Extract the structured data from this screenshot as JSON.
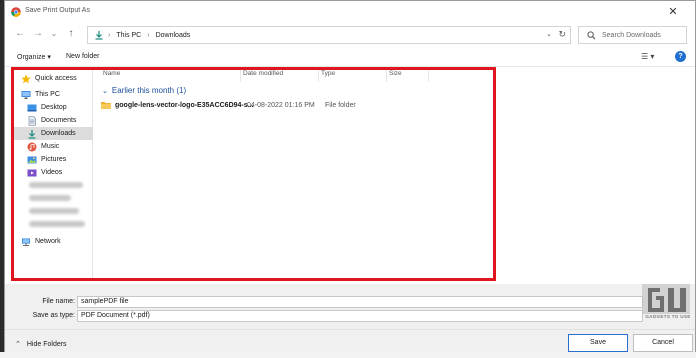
{
  "window": {
    "title": "Save Print Output As",
    "close_glyph": "✕"
  },
  "navigation": {
    "back_glyph": "←",
    "forward_glyph": "→",
    "history_glyph": "⌄",
    "up_glyph": "↑",
    "address": {
      "icon": "download-icon",
      "crumbs": [
        "This PC",
        "Downloads"
      ],
      "separator": "›",
      "dropdown_glyph": "⌄",
      "refresh_glyph": "↻"
    },
    "search": {
      "placeholder": "Search Downloads",
      "icon": "search-icon"
    }
  },
  "commandbar": {
    "organize": "Organize ▾",
    "new_folder": "New folder",
    "view_glyph": "☰ ▾",
    "help_glyph": "?"
  },
  "sidebar": {
    "items": [
      {
        "label": "Quick access",
        "icon": "star-icon"
      },
      {
        "label": "This PC",
        "icon": "computer-icon"
      },
      {
        "label": "Desktop",
        "icon": "desktop-icon"
      },
      {
        "label": "Documents",
        "icon": "documents-icon"
      },
      {
        "label": "Downloads",
        "icon": "download-icon",
        "selected": true
      },
      {
        "label": "Music",
        "icon": "music-icon"
      },
      {
        "label": "Pictures",
        "icon": "pictures-icon"
      },
      {
        "label": "Videos",
        "icon": "videos-icon"
      },
      {
        "label": "Network",
        "icon": "network-icon"
      }
    ]
  },
  "filelist": {
    "columns": [
      "Name",
      "Date modified",
      "Type",
      "Size"
    ],
    "group": {
      "label": "Earlier this month (1)",
      "chevron": "⌄"
    },
    "rows": [
      {
        "name": "google-lens-vector-logo-E35ACC6D94-s...",
        "date": "04-08-2022 01:16 PM",
        "type": "File folder",
        "icon": "folder-icon"
      }
    ]
  },
  "form": {
    "filename_label": "File name:",
    "filename_value": "samplePDF file",
    "savetype_label": "Save as type:",
    "savetype_value": "PDF Document (*.pdf)"
  },
  "footer": {
    "hide_folders": "Hide Folders",
    "hide_chevron": "⌃",
    "save": "Save",
    "cancel": "Cancel"
  },
  "watermark": {
    "logo_text": "GU",
    "tagline": "GADGETS TO USE"
  },
  "colors": {
    "highlight": "#e0161e",
    "accent": "#1f6fd0",
    "group_header": "#1a4f9c",
    "folder": "#f2c14e"
  }
}
